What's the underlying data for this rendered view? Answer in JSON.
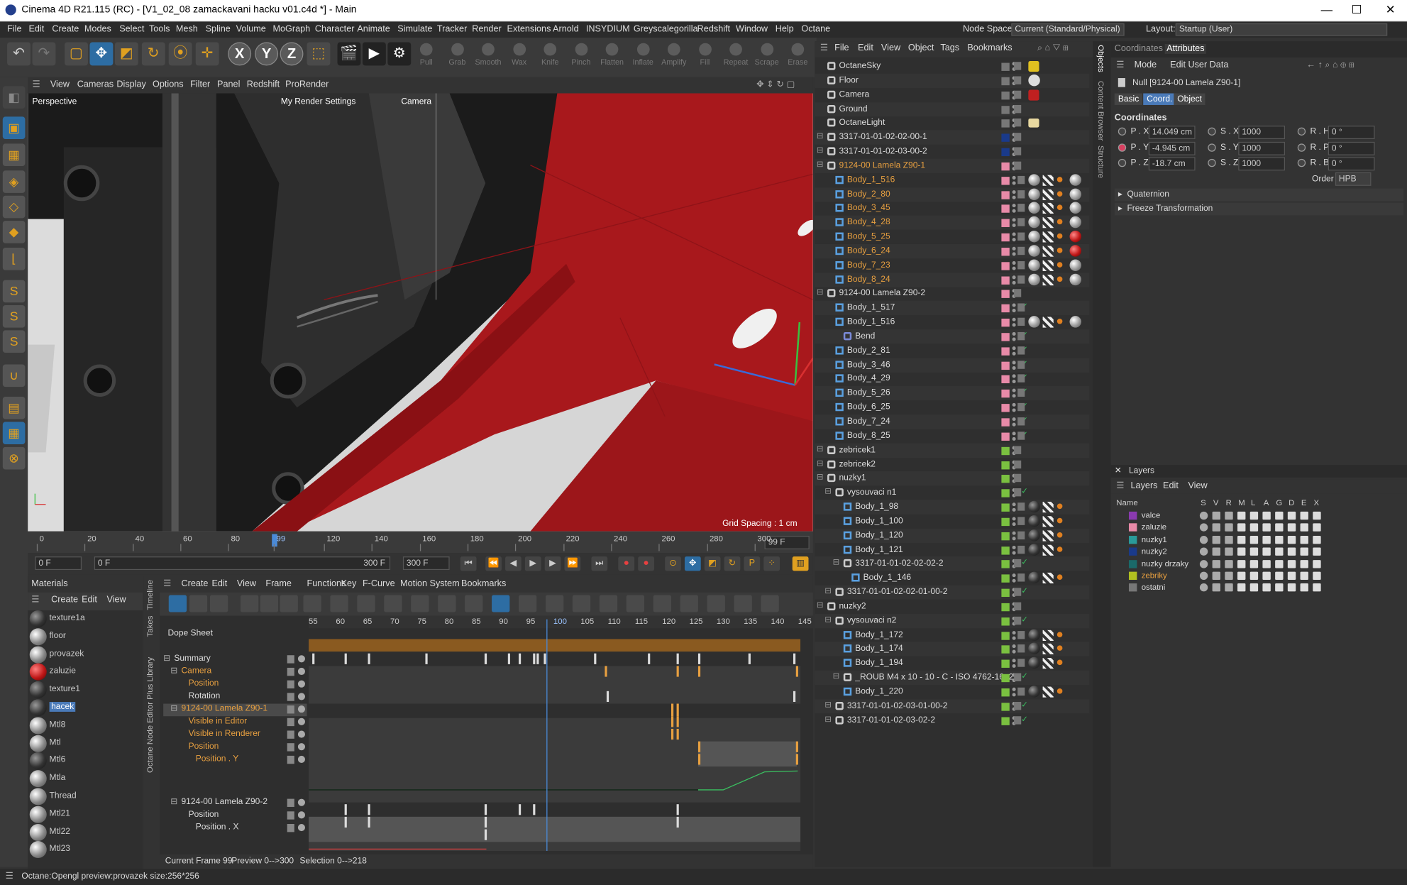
{
  "window": {
    "title": "Cinema 4D R21.115 (RC) - [V1_02_08 zamackavani hacku v01.c4d *] - Main",
    "min": "—",
    "max": "☐",
    "close": "✕"
  },
  "menu": [
    "File",
    "Edit",
    "Create",
    "Modes",
    "Select",
    "Tools",
    "Mesh",
    "Spline",
    "Volume",
    "MoGraph",
    "Character",
    "Animate",
    "Simulate",
    "Tracker",
    "Render",
    "Extensions",
    "Arnold",
    "INSYDIUM",
    "Greyscalegorilla",
    "Redshift",
    "Window",
    "Help",
    "Octane"
  ],
  "node_space": {
    "label": "Node Space:",
    "value": "Current (Standard/Physical)"
  },
  "layout": {
    "label": "Layout:",
    "value": "Startup (User)"
  },
  "sculpt_tools": [
    "Pull",
    "Grab",
    "Smooth",
    "Wax",
    "Knife",
    "Pinch",
    "Flatten",
    "Inflate",
    "Amplify",
    "Fill",
    "Repeat",
    "Scrape",
    "Erase"
  ],
  "axis_buttons": [
    "X",
    "Y",
    "Z"
  ],
  "viewport": {
    "menu": [
      "View",
      "Cameras",
      "Display",
      "Options",
      "Filter",
      "Panel",
      "Redshift",
      "ProRender"
    ],
    "name": "Perspective",
    "render_settings": "My Render Settings",
    "camera": "Camera",
    "grid_spacing": "Grid Spacing : 1 cm"
  },
  "timeline": {
    "ticks": [
      "0",
      "20",
      "40",
      "60",
      "80",
      "99",
      "120",
      "140",
      "160",
      "180",
      "200",
      "220",
      "240",
      "260",
      "280",
      "300"
    ],
    "current": "99 F",
    "start": "0 F",
    "start2": "0 F",
    "end": "300 F",
    "end2": "300 F"
  },
  "materials": {
    "title": "Materials",
    "menu": [
      "Create",
      "Edit",
      "View"
    ],
    "items": [
      "texture1a",
      "floor",
      "provazek",
      "zaluzie",
      "texture1",
      "hacek",
      "Mtl8",
      "Mtl",
      "Mtl6",
      "Mtla",
      "Thread",
      "Mtl21",
      "Mtl22",
      "Mtl23"
    ],
    "selected": "hacek"
  },
  "side_tabs": [
    "Timeline",
    "Takes",
    "Plus Library",
    "Octane Node Editor"
  ],
  "dope": {
    "menu": [
      "Create",
      "Edit",
      "View",
      "Frame",
      "Functions",
      "Key",
      "F-Curve",
      "Motion System",
      "Bookmarks"
    ],
    "title": "Dope Sheet",
    "frames": [
      "55",
      "60",
      "65",
      "70",
      "75",
      "80",
      "85",
      "90",
      "95",
      "100",
      "105",
      "110",
      "115",
      "120",
      "125",
      "130",
      "135",
      "140",
      "145"
    ],
    "tracks": [
      {
        "name": "Summary",
        "color": "#ddd",
        "indent": 0
      },
      {
        "name": "Camera",
        "color": "#e8a040",
        "indent": 1
      },
      {
        "name": "Position",
        "color": "#e8a040",
        "indent": 2
      },
      {
        "name": "Rotation",
        "color": "#ddd",
        "indent": 2
      },
      {
        "name": "9124-00 Lamela Z90-1",
        "color": "#e8a040",
        "indent": 1
      },
      {
        "name": "Visible in Editor",
        "color": "#e8a040",
        "indent": 2
      },
      {
        "name": "Visible in Renderer",
        "color": "#e8a040",
        "indent": 2
      },
      {
        "name": "Position",
        "color": "#e8a040",
        "indent": 2
      },
      {
        "name": "Position . Y",
        "color": "#e8a040",
        "indent": 3
      },
      {
        "name": "9124-00 Lamela Z90-2",
        "color": "#ddd",
        "indent": 1
      },
      {
        "name": "Position",
        "color": "#ddd",
        "indent": 2
      },
      {
        "name": "Position . X",
        "color": "#ddd",
        "indent": 3
      }
    ],
    "footer": {
      "current": "Current Frame  99",
      "preview": "Preview  0-->300",
      "selection": "Selection 0-->218"
    }
  },
  "objects": {
    "menu": [
      "File",
      "Edit",
      "View",
      "Object",
      "Tags",
      "Bookmarks"
    ],
    "rows": [
      {
        "name": "OctaneSky",
        "ind": 0,
        "sw": "#777",
        "col": "#ddd",
        "type": "sky"
      },
      {
        "name": "Floor",
        "ind": 0,
        "sw": "#777",
        "col": "#ddd",
        "type": "floor"
      },
      {
        "name": "Camera",
        "ind": 0,
        "sw": "#777",
        "col": "#ddd",
        "type": "cam"
      },
      {
        "name": "Ground",
        "ind": 0,
        "sw": "#777",
        "col": "#ddd",
        "type": "null"
      },
      {
        "name": "OctaneLight",
        "ind": 0,
        "sw": "#777",
        "col": "#ddd",
        "type": "light"
      },
      {
        "name": "3317-01-01-02-02-00-1",
        "ind": 0,
        "sw": "#1a3a8a",
        "col": "#ddd",
        "type": "null"
      },
      {
        "name": "3317-01-01-02-03-00-2",
        "ind": 0,
        "sw": "#1a3a8a",
        "col": "#ddd",
        "type": "null"
      },
      {
        "name": "9124-00 Lamela Z90-1",
        "ind": 0,
        "sw": "#e88aa8",
        "col": "#e8a040",
        "type": "null"
      },
      {
        "name": "Body_1_516",
        "ind": 1,
        "sw": "#e88aa8",
        "col": "#e8a040",
        "type": "poly"
      },
      {
        "name": "Body_2_80",
        "ind": 1,
        "sw": "#e88aa8",
        "col": "#e8a040",
        "type": "poly"
      },
      {
        "name": "Body_3_45",
        "ind": 1,
        "sw": "#e88aa8",
        "col": "#e8a040",
        "type": "poly"
      },
      {
        "name": "Body_4_28",
        "ind": 1,
        "sw": "#e88aa8",
        "col": "#e8a040",
        "type": "poly"
      },
      {
        "name": "Body_5_25",
        "ind": 1,
        "sw": "#e88aa8",
        "col": "#e8a040",
        "type": "poly"
      },
      {
        "name": "Body_6_24",
        "ind": 1,
        "sw": "#e88aa8",
        "col": "#e8a040",
        "type": "poly"
      },
      {
        "name": "Body_7_23",
        "ind": 1,
        "sw": "#e88aa8",
        "col": "#e8a040",
        "type": "poly"
      },
      {
        "name": "Body_8_24",
        "ind": 1,
        "sw": "#e88aa8",
        "col": "#e8a040",
        "type": "poly"
      },
      {
        "name": "9124-00 Lamela Z90-2",
        "ind": 0,
        "sw": "#e88aa8",
        "col": "#ddd",
        "type": "null"
      },
      {
        "name": "Body_1_517",
        "ind": 1,
        "sw": "#e88aa8",
        "col": "#ddd",
        "type": "poly"
      },
      {
        "name": "Body_1_516",
        "ind": 1,
        "sw": "#e88aa8",
        "col": "#ddd",
        "type": "poly"
      },
      {
        "name": "Bend",
        "ind": 2,
        "sw": "#e88aa8",
        "col": "#ddd",
        "type": "bend"
      },
      {
        "name": "Body_2_81",
        "ind": 1,
        "sw": "#e88aa8",
        "col": "#ddd",
        "type": "poly"
      },
      {
        "name": "Body_3_46",
        "ind": 1,
        "sw": "#e88aa8",
        "col": "#ddd",
        "type": "poly"
      },
      {
        "name": "Body_4_29",
        "ind": 1,
        "sw": "#e88aa8",
        "col": "#ddd",
        "type": "poly"
      },
      {
        "name": "Body_5_26",
        "ind": 1,
        "sw": "#e88aa8",
        "col": "#ddd",
        "type": "poly"
      },
      {
        "name": "Body_6_25",
        "ind": 1,
        "sw": "#e88aa8",
        "col": "#ddd",
        "type": "poly"
      },
      {
        "name": "Body_7_24",
        "ind": 1,
        "sw": "#e88aa8",
        "col": "#ddd",
        "type": "poly"
      },
      {
        "name": "Body_8_25",
        "ind": 1,
        "sw": "#e88aa8",
        "col": "#ddd",
        "type": "poly"
      },
      {
        "name": "zebricek1",
        "ind": 0,
        "sw": "#7ac040",
        "col": "#ddd",
        "type": "null"
      },
      {
        "name": "zebricek2",
        "ind": 0,
        "sw": "#7ac040",
        "col": "#ddd",
        "type": "null"
      },
      {
        "name": "nuzky1",
        "ind": 0,
        "sw": "#7ac040",
        "col": "#ddd",
        "type": "null"
      },
      {
        "name": "vysouvaci n1",
        "ind": 1,
        "sw": "#7ac040",
        "col": "#ddd",
        "type": "null"
      },
      {
        "name": "Body_1_98",
        "ind": 2,
        "sw": "#7ac040",
        "col": "#ddd",
        "type": "poly"
      },
      {
        "name": "Body_1_100",
        "ind": 2,
        "sw": "#7ac040",
        "col": "#ddd",
        "type": "poly"
      },
      {
        "name": "Body_1_120",
        "ind": 2,
        "sw": "#7ac040",
        "col": "#ddd",
        "type": "poly"
      },
      {
        "name": "Body_1_121",
        "ind": 2,
        "sw": "#7ac040",
        "col": "#ddd",
        "type": "poly"
      },
      {
        "name": "3317-01-01-02-02-02-2",
        "ind": 2,
        "sw": "#7ac040",
        "col": "#ddd",
        "type": "null"
      },
      {
        "name": "Body_1_146",
        "ind": 3,
        "sw": "#7ac040",
        "col": "#ddd",
        "type": "poly"
      },
      {
        "name": "3317-01-01-02-02-01-00-2",
        "ind": 1,
        "sw": "#7ac040",
        "col": "#ddd",
        "type": "null"
      },
      {
        "name": "nuzky2",
        "ind": 0,
        "sw": "#7ac040",
        "col": "#ddd",
        "type": "null"
      },
      {
        "name": "vysouvaci n2",
        "ind": 1,
        "sw": "#7ac040",
        "col": "#ddd",
        "type": "null"
      },
      {
        "name": "Body_1_172",
        "ind": 2,
        "sw": "#7ac040",
        "col": "#ddd",
        "type": "poly"
      },
      {
        "name": "Body_1_174",
        "ind": 2,
        "sw": "#7ac040",
        "col": "#ddd",
        "type": "poly"
      },
      {
        "name": "Body_1_194",
        "ind": 2,
        "sw": "#7ac040",
        "col": "#ddd",
        "type": "poly"
      },
      {
        "name": "_ROUB M4 x 10 - 10 - C - ISO 4762-16_2",
        "ind": 2,
        "sw": "#7ac040",
        "col": "#ddd",
        "type": "null"
      },
      {
        "name": "Body_1_220",
        "ind": 2,
        "sw": "#7ac040",
        "col": "#ddd",
        "type": "poly"
      },
      {
        "name": "3317-01-01-02-03-01-00-2",
        "ind": 1,
        "sw": "#7ac040",
        "col": "#ddd",
        "type": "null"
      },
      {
        "name": "3317-01-01-02-03-02-2",
        "ind": 1,
        "sw": "#7ac040",
        "col": "#ddd",
        "type": "null"
      }
    ]
  },
  "right_tabs": [
    "Objects",
    "Content Browser",
    "Structure"
  ],
  "attributes": {
    "tabs": [
      "Coordinates",
      "Attributes"
    ],
    "menu": [
      "Mode",
      "Edit",
      "User Data"
    ],
    "object": "Null [9124-00 Lamela Z90-1]",
    "subtabs": [
      "Basic",
      "Coord.",
      "Object"
    ],
    "section": "Coordinates",
    "pos": [
      {
        "l": "P . X",
        "v": "14.049 cm"
      },
      {
        "l": "P . Y",
        "v": "-4.945 cm"
      },
      {
        "l": "P . Z",
        "v": "-18.7 cm"
      }
    ],
    "scale": [
      {
        "l": "S . X",
        "v": "1000"
      },
      {
        "l": "S . Y",
        "v": "1000"
      },
      {
        "l": "S . Z",
        "v": "1000"
      }
    ],
    "rot": [
      {
        "l": "R . H",
        "v": "0 °"
      },
      {
        "l": "R . P",
        "v": "0 °"
      },
      {
        "l": "R . B",
        "v": "0 °"
      }
    ],
    "order_label": "Order",
    "order": "HPB",
    "quaternion": "Quaternion",
    "freeze": "Freeze Transformation"
  },
  "layers": {
    "title": "Layers",
    "menu": [
      "Layers",
      "Edit",
      "View"
    ],
    "cols": [
      "Name",
      "S",
      "V",
      "R",
      "M",
      "L",
      "A",
      "G",
      "D",
      "E",
      "X"
    ],
    "items": [
      {
        "name": "valce",
        "color": "#8a3ab0",
        "tc": "#ddd"
      },
      {
        "name": "zaluzie",
        "color": "#e88aa8",
        "tc": "#ddd"
      },
      {
        "name": "nuzky1",
        "color": "#2a9a9a",
        "tc": "#ddd"
      },
      {
        "name": "nuzky2",
        "color": "#1a3a8a",
        "tc": "#ddd"
      },
      {
        "name": "nuzky drzaky",
        "color": "#1a6a6a",
        "tc": "#ddd"
      },
      {
        "name": "zebriky",
        "color": "#b0c020",
        "tc": "#e8a040"
      },
      {
        "name": "ostatni",
        "color": "#777",
        "tc": "#ddd"
      }
    ]
  },
  "status": "Octane:Opengl preview:provazek  size:256*256"
}
